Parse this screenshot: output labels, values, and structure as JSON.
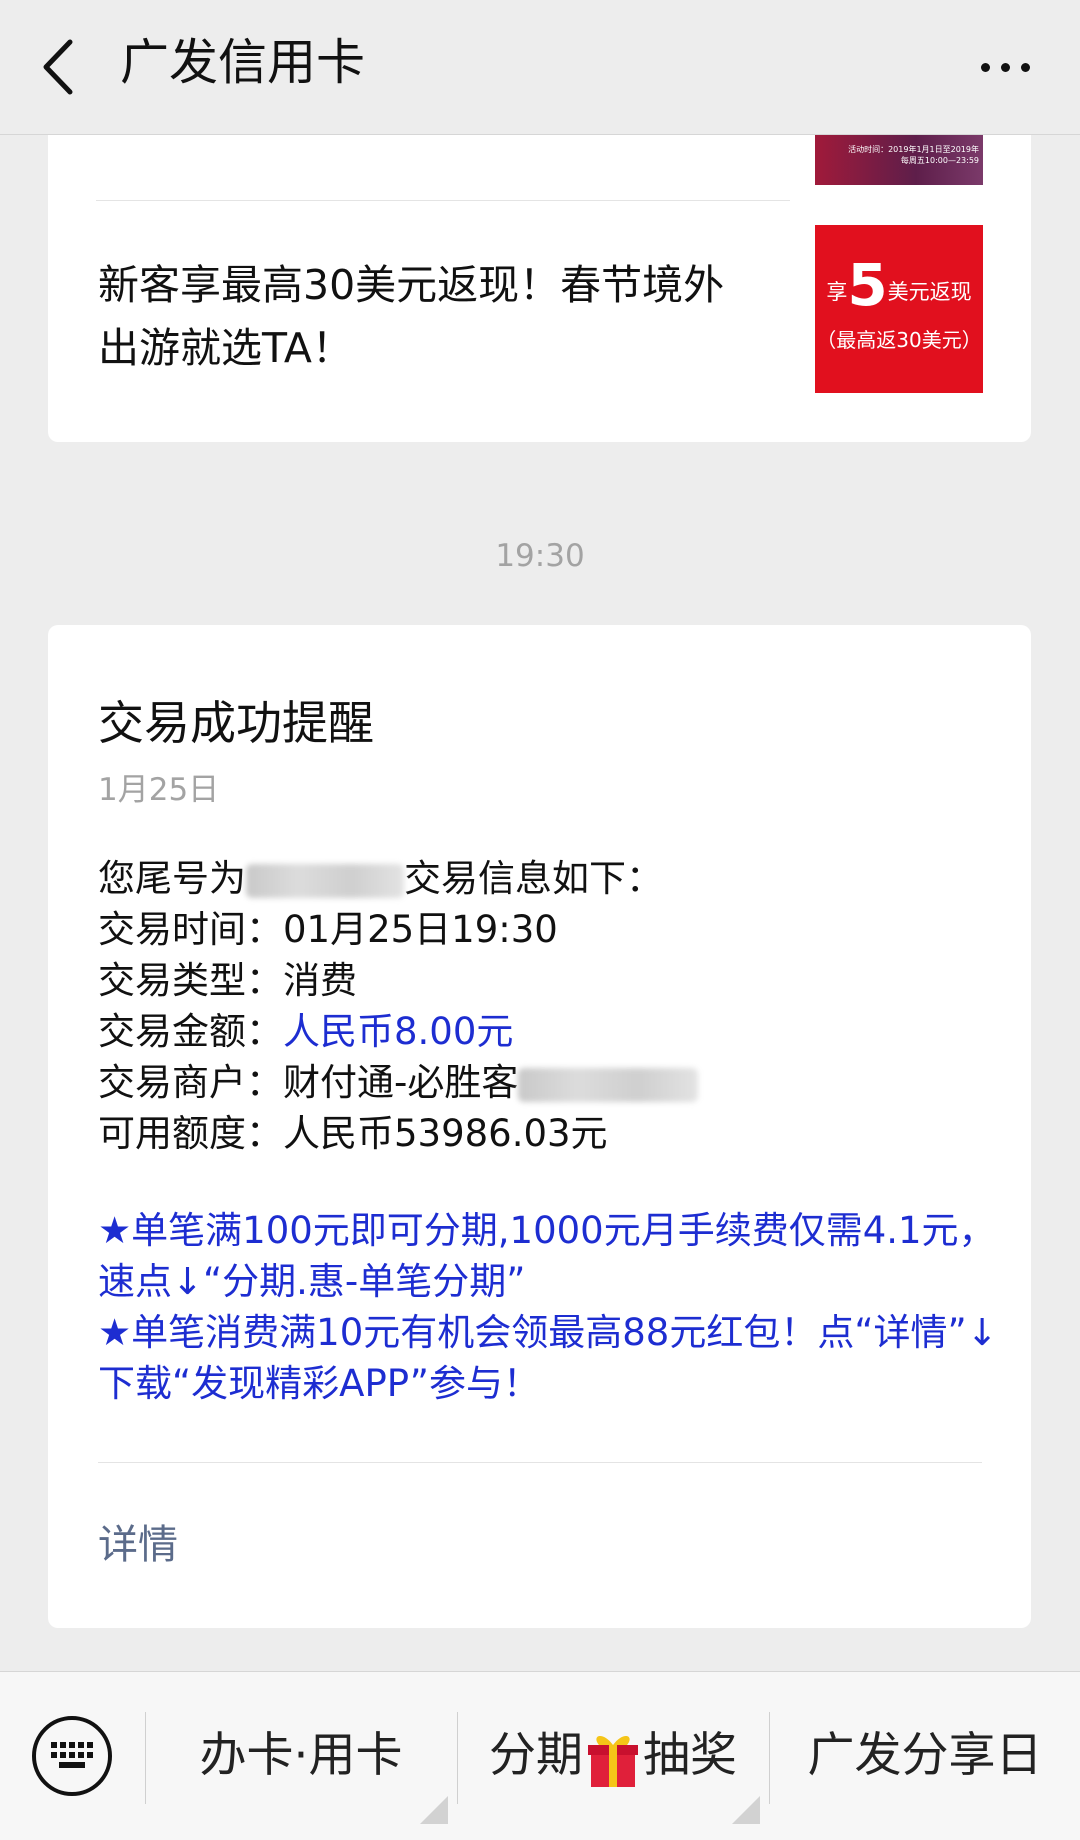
{
  "header": {
    "title": "广发信用卡",
    "back_icon": "chevron-left-icon",
    "more_icon": "more-dots-icon"
  },
  "prev_card": {
    "cut_text": "",
    "thumb_top_text": [
      "活动时间：2019年1月1日至2019年",
      "每周五10:00—23:59"
    ],
    "article_title": "新客享最高30美元返现！春节境外出游就选TA！",
    "thumb_red": {
      "prefix": "享",
      "big": "5",
      "suffix": "美元返现",
      "line2": "（最高返30美元）"
    }
  },
  "timestamp": "19:30",
  "message": {
    "title": "交易成功提醒",
    "date": "1月25日",
    "intro_prefix": "您尾号为",
    "intro_suffix": "交易信息如下：",
    "time_label": "交易时间：",
    "time_value": "01月25日19:30",
    "type_label": "交易类型：",
    "type_value": "消费",
    "amount_label": "交易金额：",
    "amount_value": "人民币8.00元",
    "merchant_label": "交易商户：",
    "merchant_value": "财付通-必胜客",
    "credit_label": "可用额度：",
    "credit_value": "人民币53986.03元",
    "promo_1": "★单笔满100元即可分期,1000元月手续费仅需4.1元，速点↓“分期.惠-单笔分期”",
    "promo_2": "★单笔消费满10元有机会领最高88元红包！点“详情”↓下载“发现精彩APP”参与！",
    "detail_link": "详情"
  },
  "bottom_menu": {
    "keyboard_icon": "keyboard-icon",
    "item1": "办卡·用卡",
    "item2_prefix": "分期",
    "item2_suffix": "抽奖",
    "item3": "广发分享日"
  },
  "colors": {
    "background": "#ededed",
    "link_blue": "#1d2dd1",
    "detail_link": "#5b6b8a",
    "muted": "#a3a3a3"
  }
}
